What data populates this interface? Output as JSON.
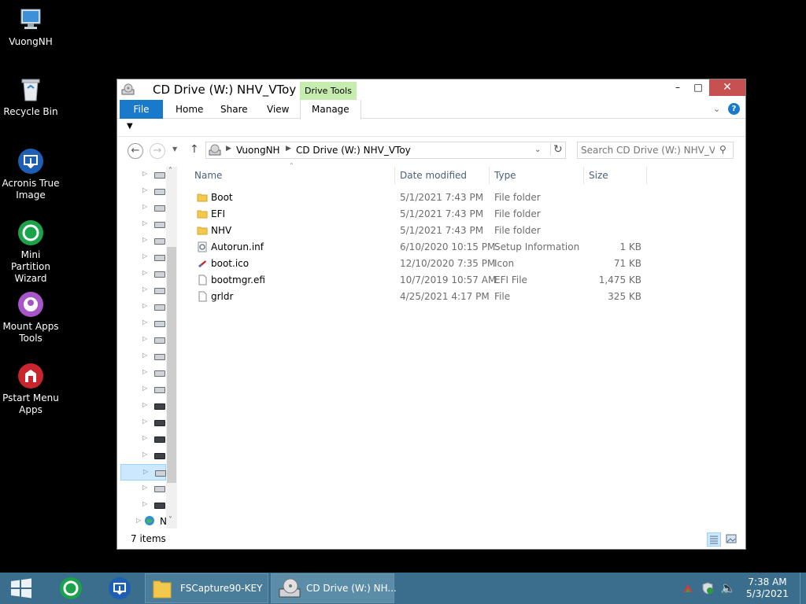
{
  "desktop": {
    "icons": [
      {
        "label": "VuongNH",
        "icon": "computer-icon"
      },
      {
        "label": "Recycle Bin",
        "icon": "recycle-bin-icon"
      },
      {
        "label": "Acronis True Image",
        "icon": "acronis-icon"
      },
      {
        "label": "Mini Partition Wizard",
        "icon": "partition-wizard-icon"
      },
      {
        "label": "Mount Apps Tools",
        "icon": "mount-apps-icon"
      },
      {
        "label": "Pstart Menu Apps",
        "icon": "pstart-icon"
      }
    ]
  },
  "window": {
    "title": "CD Drive (W:) NHV_VToy",
    "context_tab": "Drive Tools",
    "controls": {
      "minimize": "–",
      "maximize": "□",
      "close": "✕"
    },
    "ribbon_tabs": [
      "File",
      "Home",
      "Share",
      "View",
      "Manage"
    ],
    "address": {
      "crumbs": [
        "VuongNH",
        "CD Drive (W:) NHV_VToy"
      ]
    },
    "search": {
      "placeholder": "Search CD Drive (W:) NHV_VT..."
    },
    "columns": {
      "name": "Name",
      "date": "Date modified",
      "type": "Type",
      "size": "Size"
    },
    "files": [
      {
        "name": "Boot",
        "date": "5/1/2021 7:43 PM",
        "type": "File folder",
        "size": "",
        "icon": "folder-icon"
      },
      {
        "name": "EFI",
        "date": "5/1/2021 7:43 PM",
        "type": "File folder",
        "size": "",
        "icon": "folder-icon"
      },
      {
        "name": "NHV",
        "date": "5/1/2021 7:43 PM",
        "type": "File folder",
        "size": "",
        "icon": "folder-icon"
      },
      {
        "name": "Autorun.inf",
        "date": "6/10/2020 10:15 PM",
        "type": "Setup Information",
        "size": "1 KB",
        "icon": "setup-file-icon"
      },
      {
        "name": "boot.ico",
        "date": "12/10/2020 7:35 PM",
        "type": "Icon",
        "size": "71 KB",
        "icon": "ico-file-icon"
      },
      {
        "name": "bootmgr.efi",
        "date": "10/7/2019 10:57 AM",
        "type": "EFI File",
        "size": "1,475 KB",
        "icon": "file-icon"
      },
      {
        "name": "grldr",
        "date": "4/25/2021 4:17 PM",
        "type": "File",
        "size": "325 KB",
        "icon": "file-icon"
      }
    ],
    "nav_tree_last_label": "N",
    "status": {
      "item_count": "7 items"
    }
  },
  "taskbar": {
    "tasks": [
      {
        "label": "FSCapture90-KEY",
        "icon": "folder-icon"
      },
      {
        "label": "CD Drive (W:) NH...",
        "icon": "cd-drive-icon"
      }
    ],
    "clock": {
      "time": "7:38 AM",
      "date": "5/3/2021"
    }
  },
  "colors": {
    "accent": "#1979ca",
    "close": "#c75050",
    "taskbar": "#3a6e8c",
    "drive_tools": "#c7ecb0"
  }
}
